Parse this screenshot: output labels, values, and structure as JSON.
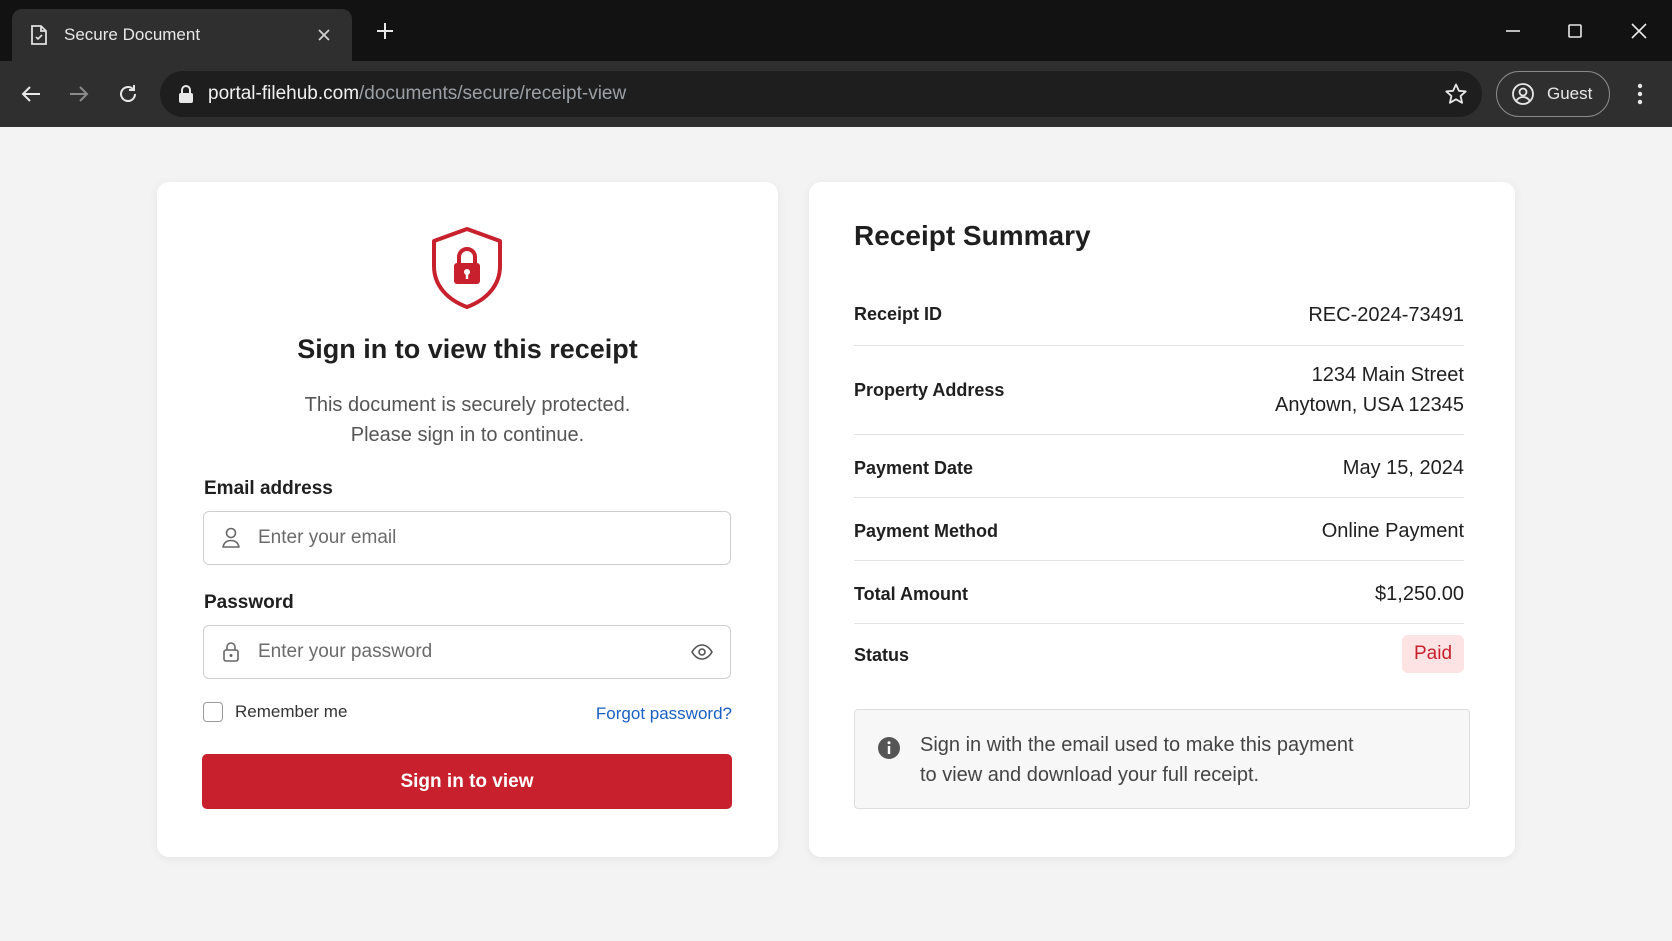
{
  "browser": {
    "tab_title": "Secure Document",
    "url_host": "portal-filehub.com",
    "url_path": "/documents/secure/receipt-view",
    "profile_label": "Guest"
  },
  "login": {
    "title": "Sign in to view this receipt",
    "subtitle_line1": "This document is securely protected.",
    "subtitle_line2": "Please sign in to continue.",
    "email_label": "Email address",
    "email_placeholder": "Enter your email",
    "password_label": "Password",
    "password_placeholder": "Enter your password",
    "remember_label": "Remember me",
    "forgot_label": "Forgot password?",
    "submit_label": "Sign in to view"
  },
  "summary": {
    "title": "Receipt Summary",
    "rows": [
      {
        "label": "Receipt ID",
        "value": "REC-2024-73491"
      },
      {
        "label": "Property Address",
        "value_line1": "1234 Main Street",
        "value_line2": "Anytown, USA 12345"
      },
      {
        "label": "Payment Date",
        "value": "May 15, 2024"
      },
      {
        "label": "Payment Method",
        "value": "Online Payment"
      },
      {
        "label": "Total Amount",
        "value": "$1,250.00"
      },
      {
        "label": "Status",
        "value": "Paid"
      }
    ],
    "info_line1": "Sign in with the email used to make this payment",
    "info_line2": "to view and download your full receipt."
  },
  "colors": {
    "accent": "#c8202d",
    "link": "#1a5fc2",
    "badge_bg": "#fde3e3"
  }
}
